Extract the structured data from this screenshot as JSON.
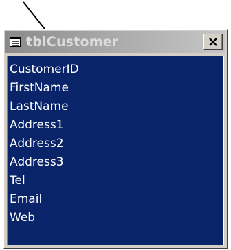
{
  "table_window": {
    "title": "tblCustomer",
    "fields": [
      "CustomerID",
      "FirstName",
      "LastName",
      "Address1",
      "Address2",
      "Address3",
      "Tel",
      "Email",
      "Web"
    ]
  },
  "icons": {
    "title_icon": "table-icon",
    "close_icon": "close-icon",
    "pointer": "arrow-pointer-icon"
  },
  "colors": {
    "list_background": "#0a246a",
    "list_text": "#ffffff",
    "titlebar_inactive": "#a8a8a8"
  }
}
